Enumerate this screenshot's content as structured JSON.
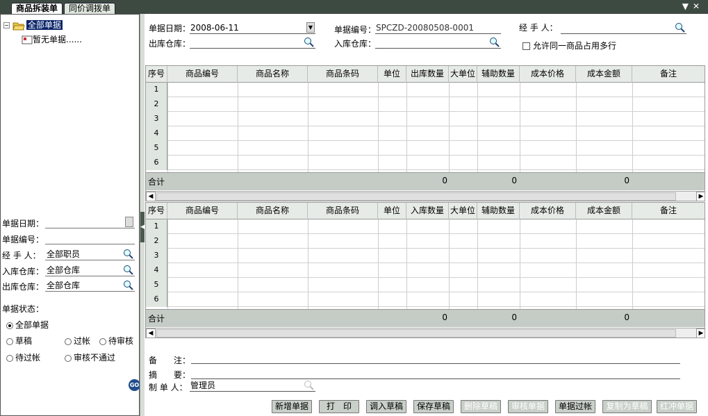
{
  "tabs": [
    {
      "label": "商品拆装单"
    },
    {
      "label": "同价调拨单"
    }
  ],
  "tree": {
    "root": "全部单据",
    "child": "暂无单据......"
  },
  "filter": {
    "date_label": "单据日期：",
    "number_label": "单据编号：",
    "handler_label": "经 手 人：",
    "handler_value": "全部职员",
    "in_wh_label": "入库仓库：",
    "in_wh_value": "全部仓库",
    "out_wh_label": "出库仓库：",
    "out_wh_value": "全部仓库",
    "status_label": "单据状态：",
    "status_options": [
      "全部单据",
      "草稿",
      "过帐",
      "待审核",
      "待过帐",
      "审核不通过"
    ],
    "status_selected": "全部单据",
    "go": "GO"
  },
  "header": {
    "date_label": "单据日期：",
    "date_value": "2008-06-11",
    "number_label": "单据编号：",
    "number_value": "SPCZD-20080508-0001",
    "handler_label": "经 手 人：",
    "out_wh_label": "出库仓库：",
    "in_wh_label": "入库仓库：",
    "allow_multi": "允许同一商品占用多行"
  },
  "out_grid": {
    "columns": [
      "序号",
      "商品编号",
      "商品名称",
      "商品条码",
      "单位",
      "出库数量",
      "大单位",
      "辅助数量",
      "成本价格",
      "成本金额",
      "备注"
    ],
    "rows": [
      "1",
      "2",
      "3",
      "4",
      "5",
      "6"
    ],
    "total_label": "合计",
    "totals": {
      "qty": "0",
      "aux": "0",
      "amount": "0"
    }
  },
  "in_grid": {
    "columns": [
      "序号",
      "商品编号",
      "商品名称",
      "商品条码",
      "单位",
      "入库数量",
      "大单位",
      "辅助数量",
      "成本价格",
      "成本金额",
      "备注"
    ],
    "rows": [
      "1",
      "2",
      "3",
      "4",
      "5",
      "6"
    ],
    "total_label": "合计",
    "totals": {
      "qty": "0",
      "aux": "0",
      "amount": "0"
    }
  },
  "footer": {
    "remark_label": "备　　注：",
    "summary_label": "摘　　要：",
    "maker_label": "制 单 人：",
    "maker_value": "管理员"
  },
  "buttons": [
    "新增单据",
    "打　印",
    "调入草稿",
    "保存草稿",
    "删除草稿",
    "审核单据",
    "单据过帐",
    "复制为草稿",
    "红冲单据"
  ]
}
